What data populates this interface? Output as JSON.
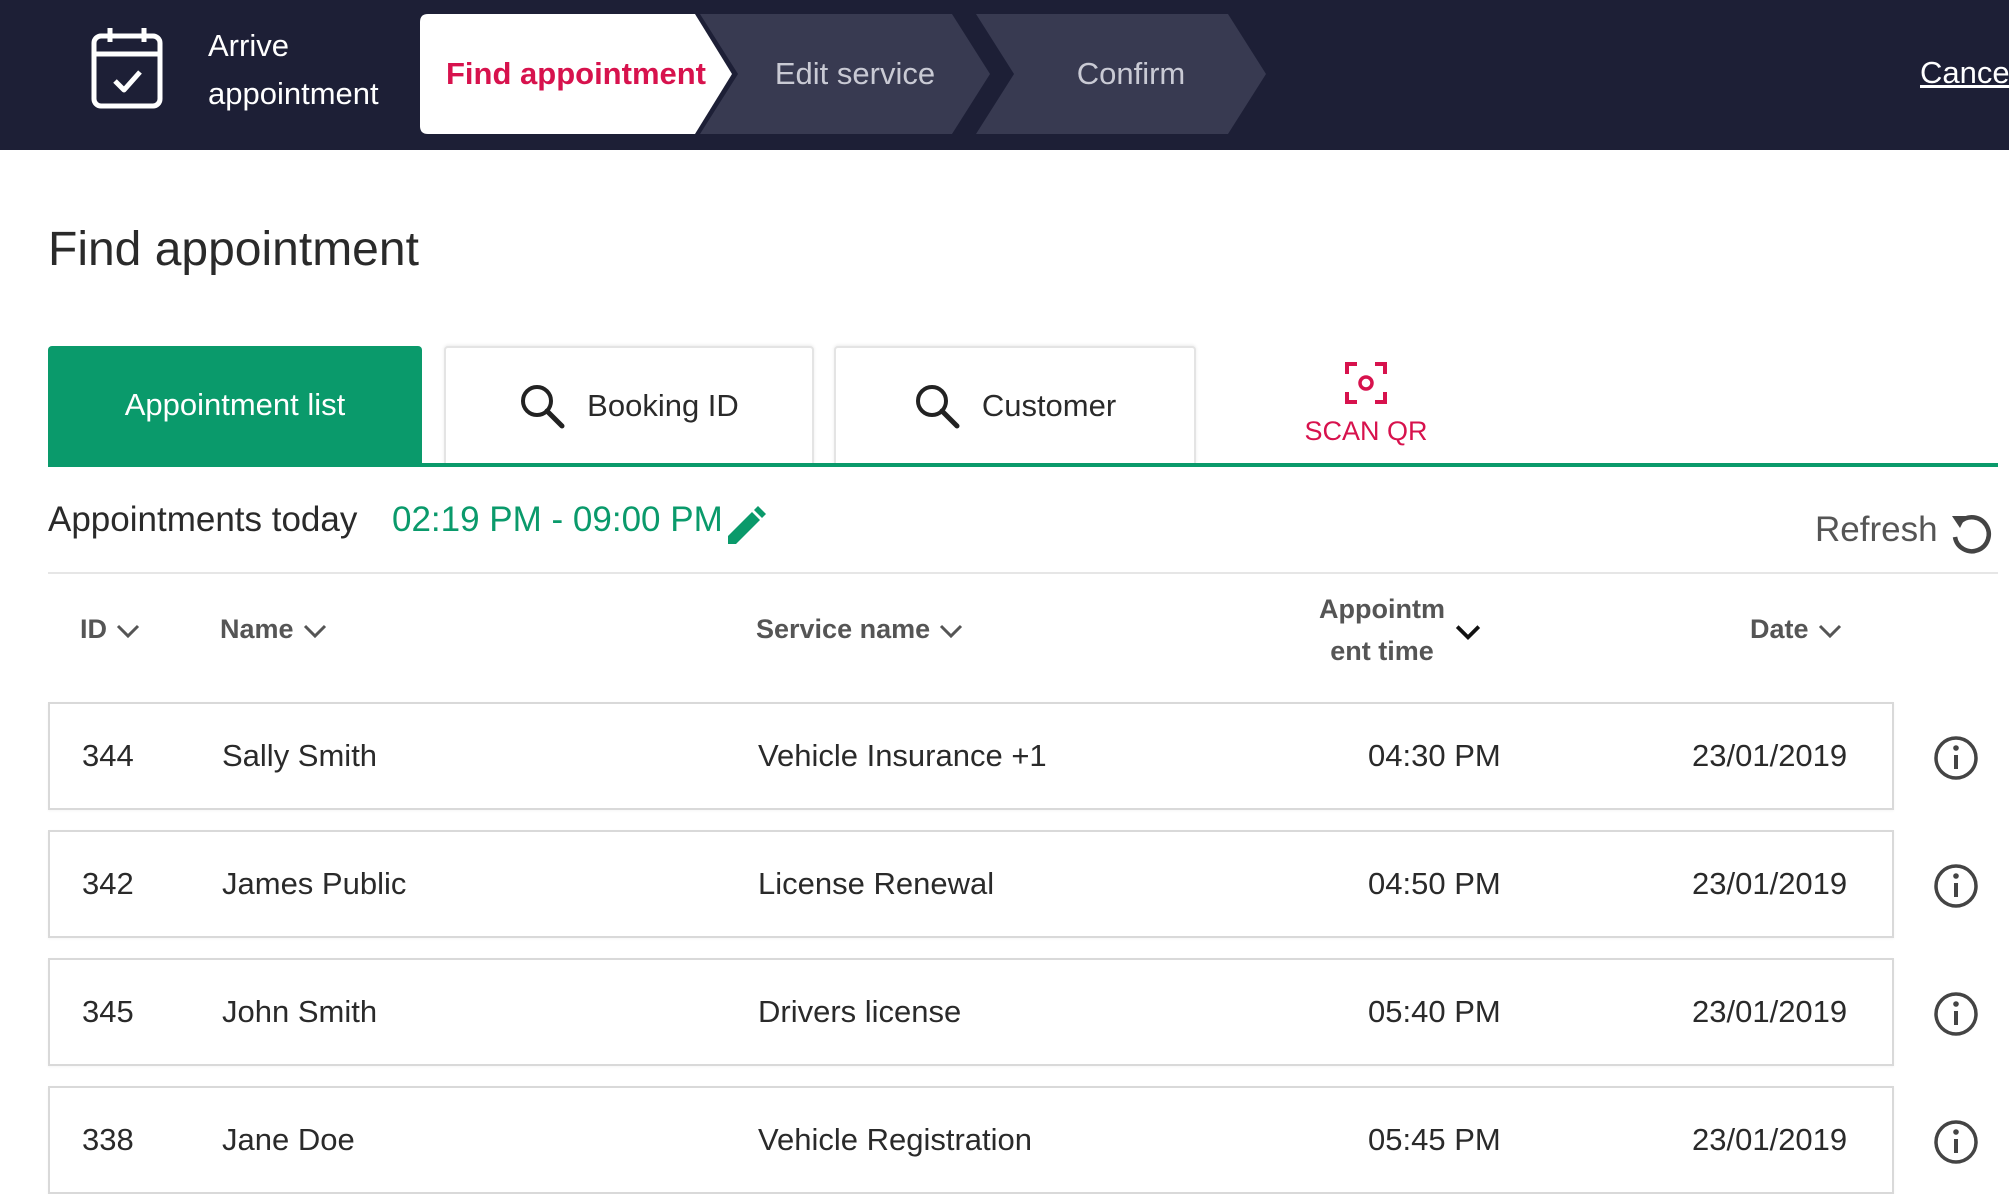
{
  "header": {
    "app_title": "Arrive appointment",
    "steps": [
      {
        "label": "Find appointment",
        "state": "active"
      },
      {
        "label": "Edit service",
        "state": "inactive"
      },
      {
        "label": "Confirm",
        "state": "inactive"
      }
    ],
    "cancel_label": "Cancel"
  },
  "page": {
    "title": "Find appointment"
  },
  "tabs": {
    "appointment_list": "Appointment list",
    "booking_id": "Booking ID",
    "customer": "Customer",
    "scan_qr": "SCAN QR"
  },
  "toolbar": {
    "subheader": "Appointments today",
    "time_range": "02:19 PM - 09:00 PM",
    "refresh_label": "Refresh"
  },
  "table": {
    "columns": {
      "id": "ID",
      "name": "Name",
      "service": "Service name",
      "time_line1": "Appointm",
      "time_line2": "ent time",
      "date": "Date"
    },
    "rows": [
      {
        "id": "344",
        "name": "Sally Smith",
        "service": "Vehicle Insurance +1",
        "time": "04:30 PM",
        "date": "23/01/2019"
      },
      {
        "id": "342",
        "name": "James Public",
        "service": "License Renewal",
        "time": "04:50 PM",
        "date": "23/01/2019"
      },
      {
        "id": "345",
        "name": "John Smith",
        "service": "Drivers license",
        "time": "05:40 PM",
        "date": "23/01/2019"
      },
      {
        "id": "338",
        "name": "Jane Doe",
        "service": "Vehicle Registration",
        "time": "05:45 PM",
        "date": "23/01/2019"
      }
    ]
  },
  "colors": {
    "header_bg": "#1d1f36",
    "accent_green": "#0a9a6b",
    "accent_red": "#d7124d",
    "step_inactive_bg": "#383a51"
  },
  "icons": [
    "calendar-check-icon",
    "search-icon",
    "qr-scan-icon",
    "pencil-icon",
    "refresh-icon",
    "chevron-down-icon",
    "info-icon"
  ]
}
